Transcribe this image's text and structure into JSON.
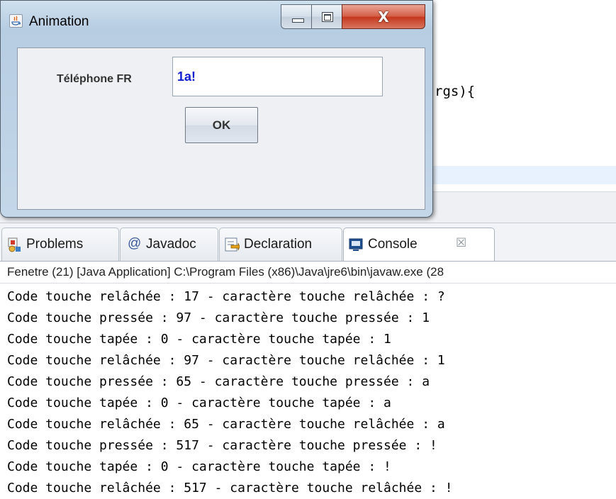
{
  "editor": {
    "code_fragment": "rgs){"
  },
  "dialog": {
    "title": "Animation",
    "field_label": "Téléphone FR",
    "field_value": "1a!",
    "ok_label": "OK",
    "close_glyph": "X"
  },
  "tabs": [
    {
      "label": "Problems",
      "icon": "problems-icon"
    },
    {
      "label": "Javadoc",
      "icon": "at-icon",
      "glyph": "@"
    },
    {
      "label": "Declaration",
      "icon": "declaration-icon"
    },
    {
      "label": "Console",
      "icon": "console-icon",
      "active": true,
      "close_glyph": "☒"
    }
  ],
  "console": {
    "header": "Fenetre (21) [Java Application] C:\\Program Files (x86)\\Java\\jre6\\bin\\javaw.exe (28",
    "lines": [
      "Code touche relâchée : 17 - caractère touche relâchée : ?",
      "Code touche pressée : 97 - caractère touche pressée : 1",
      "Code touche tapée : 0 - caractère touche tapée : 1",
      "Code touche relâchée : 97 - caractère touche relâchée : 1",
      "Code touche pressée : 65 - caractère touche pressée : a",
      "Code touche tapée : 0 - caractère touche tapée : a",
      "Code touche relâchée : 65 - caractère touche relâchée : a",
      "Code touche pressée : 517 - caractère touche pressée : !",
      "Code touche tapée : 0 - caractère touche tapée : !",
      "Code touche relâchée : 517 - caractère touche relâchée : !"
    ]
  }
}
